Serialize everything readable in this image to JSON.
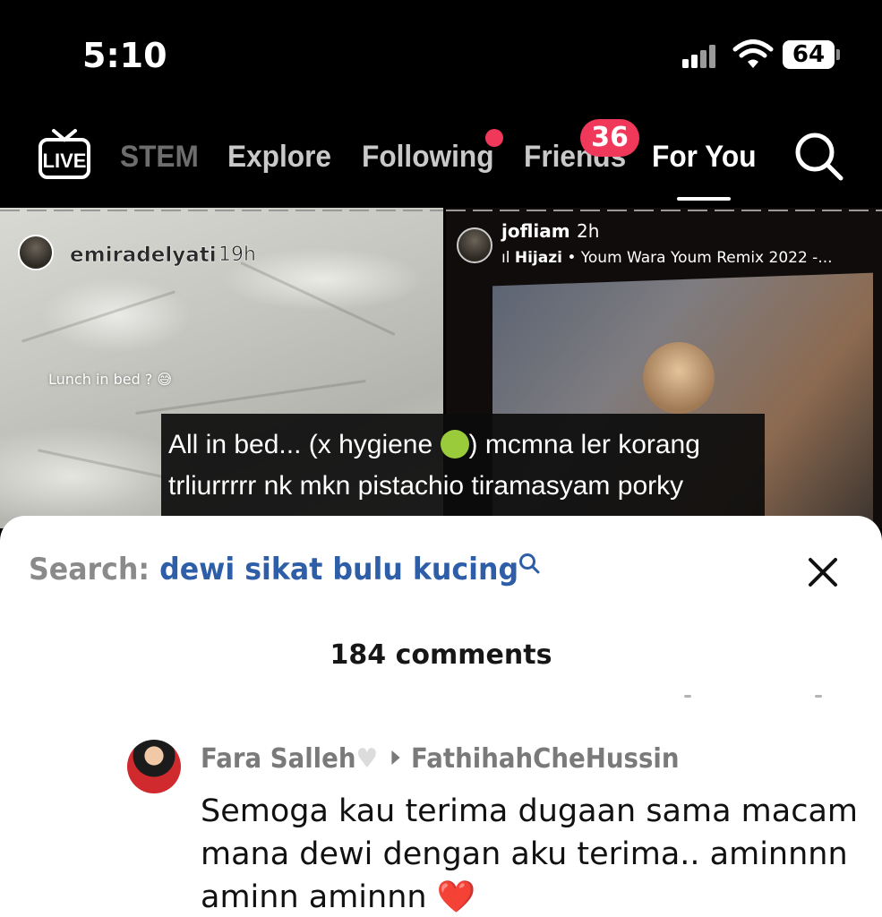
{
  "status_bar": {
    "time": "5:10",
    "battery": "64"
  },
  "nav": {
    "tabs": [
      {
        "label": "STEM"
      },
      {
        "label": "Explore"
      },
      {
        "label": "Following"
      },
      {
        "label": "Friends"
      },
      {
        "label": "For You"
      }
    ],
    "live_label": "LIVE",
    "friends_badge": "36",
    "active_tab": "For You"
  },
  "feed": {
    "left_post": {
      "username": "emiradelyati",
      "time": "19h",
      "sticker_text": "Lunch in bed ? 😅"
    },
    "right_post": {
      "username": "jofliam",
      "time": "2h",
      "music_artist": "Hijazi",
      "music_title": "Youm Wara Youm Remix 2022 -..."
    },
    "caption_line1_a": "All in bed... (x hygiene ",
    "caption_line1_b": ") mcmna ler korang",
    "caption_line2": "trliurrrrr nk mkn pistachio tiramasyam porky"
  },
  "sheet": {
    "search_label": "Search:",
    "search_query": "dewi sikat bulu kucing",
    "comment_count": "184 comments",
    "comments": [
      {
        "author": "Fara Salleh",
        "reply_to": "FathihahCheHussin",
        "text": "Semoga kau terima dugaan sama macam mana dewi dengan aku terima.. aminnnn aminn aminnn",
        "heart": "❤️"
      }
    ]
  }
}
